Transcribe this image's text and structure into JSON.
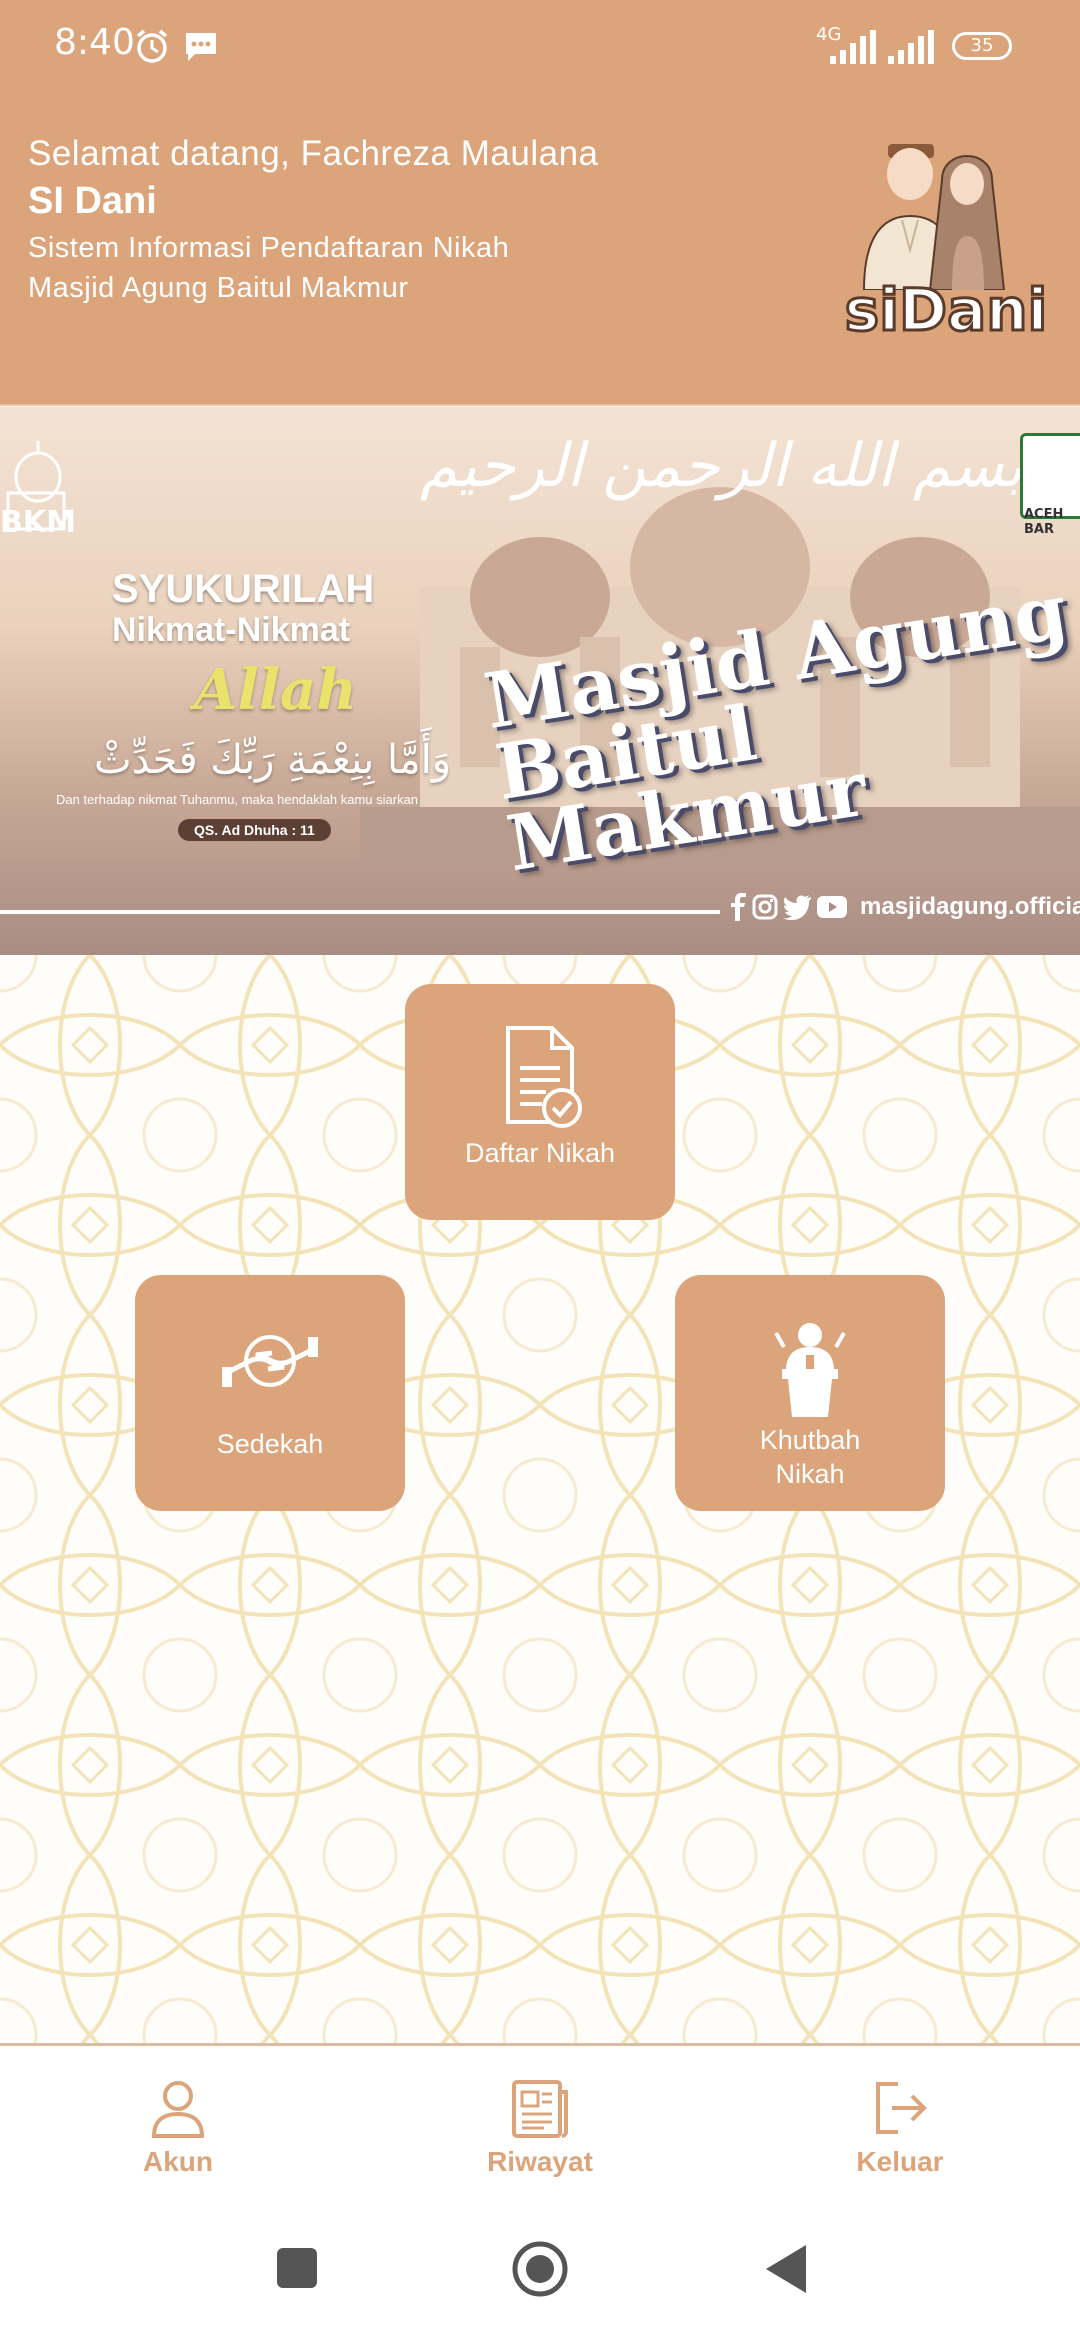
{
  "status_bar": {
    "time": "8:40",
    "network_label": "4G",
    "battery": "35"
  },
  "header": {
    "greeting": "Selamat datang, Fachreza Maulana",
    "app_name": "SI Dani",
    "subtitle_line1": "Sistem Informasi Pendaftaran Nikah",
    "subtitle_line2": "Masjid Agung Baitul Makmur",
    "logo_text": "siDani"
  },
  "banner": {
    "bismillah": "بسم الله الرحمن الرحيم",
    "org_badge": "BKM",
    "region_badge": "ACEH BAR",
    "heading_line1": "SYUKURILAH",
    "heading_line2": "Nikmat-Nikmat",
    "heading_line3": "Allah",
    "arabic_verse": "وَأَمَّا بِنِعْمَةِ رَبِّكَ فَحَدِّثْ",
    "translation": "Dan terhadap nikmat Tuhanmu, maka hendaklah kamu siarkan",
    "surah_ref": "QS. Ad Dhuha : 11",
    "mosque_title_line1": "Masjid Agung",
    "mosque_title_line2": "Baitul Makmur",
    "social_handle": "masjidagung.official"
  },
  "menu": {
    "daftar_label": "Daftar Nikah",
    "sedekah_label": "Sedekah",
    "khutbah_label_line1": "Khutbah",
    "khutbah_label_line2": "Nikah"
  },
  "bottom_nav": {
    "akun": "Akun",
    "riwayat": "Riwayat",
    "keluar": "Keluar"
  },
  "colors": {
    "primary": "#dba47a",
    "background": "#fffdf9",
    "pattern": "#f3e3b8"
  }
}
